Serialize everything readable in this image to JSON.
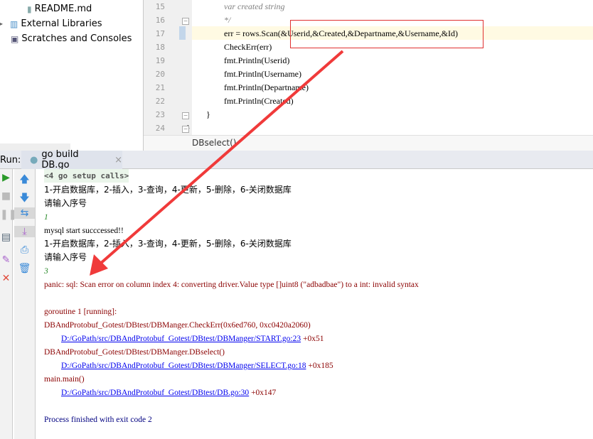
{
  "project_tree": {
    "items": [
      "README.md",
      "External Libraries",
      "Scratches and Consoles"
    ]
  },
  "editor": {
    "lines": [
      {
        "num": "15",
        "text": "var created string",
        "type": "comment"
      },
      {
        "num": "16",
        "text": "*/",
        "type": "comment"
      },
      {
        "num": "17",
        "text": "err = rows.Scan(&Userid,&Created,&Departname,&Username,&Id)",
        "type": "code"
      },
      {
        "num": "18",
        "text": "CheckErr(err)",
        "type": "code"
      },
      {
        "num": "19",
        "text": "fmt.Println(Userid)",
        "type": "code"
      },
      {
        "num": "20",
        "text": "fmt.Println(Username)",
        "type": "code"
      },
      {
        "num": "21",
        "text": "fmt.Println(Departname)",
        "type": "code"
      },
      {
        "num": "22",
        "text": "fmt.Println(Created)",
        "type": "code"
      },
      {
        "num": "23",
        "text": "}",
        "type": "code"
      },
      {
        "num": "24",
        "text": "}",
        "type": "code"
      }
    ],
    "breadcrumb": "DBselect()"
  },
  "run": {
    "label": "Run:",
    "tab": "go build DB.go",
    "close": "×"
  },
  "console": {
    "setup": "<4 go setup calls>",
    "menu1": "1-开启数据库，2-插入，3-查询，4-更新，5-删除，6-关闭数据库",
    "prompt1": "请输入序号",
    "input1": "1",
    "started": "mysql start succcessed!!",
    "menu2": "1-开启数据库，2-插入，3-查询，4-更新，5-删除，6-关闭数据库",
    "prompt2": "请输入序号",
    "input2": "3",
    "panic": "panic: sql: Scan error on column index 4: converting driver.Value type []uint8 (\"adbadbae\") to a int: invalid syntax",
    "goroutine": "goroutine 1 [running]:",
    "frame1": "DBAndProtobuf_Gotest/DBtest/DBManger.CheckErr(0x6ed760, 0xc0420a2060)",
    "link1": "D:/GoPath/src/DBAndProtobuf_Gotest/DBtest/DBManger/START.go:23",
    "off1": " +0x51",
    "frame2": "DBAndProtobuf_Gotest/DBtest/DBManger.DBselect()",
    "link2": "D:/GoPath/src/DBAndProtobuf_Gotest/DBtest/DBManger/SELECT.go:18",
    "off2": " +0x185",
    "frame3": "main.main()",
    "link3": "D:/GoPath/src/DBAndProtobuf_Gotest/DBtest/DB.go:30",
    "off3": " +0x147",
    "exit": "Process finished with exit code 2"
  },
  "colors": {
    "annotation": "#e03030",
    "error": "#8b0000",
    "link": "#0000ee"
  }
}
